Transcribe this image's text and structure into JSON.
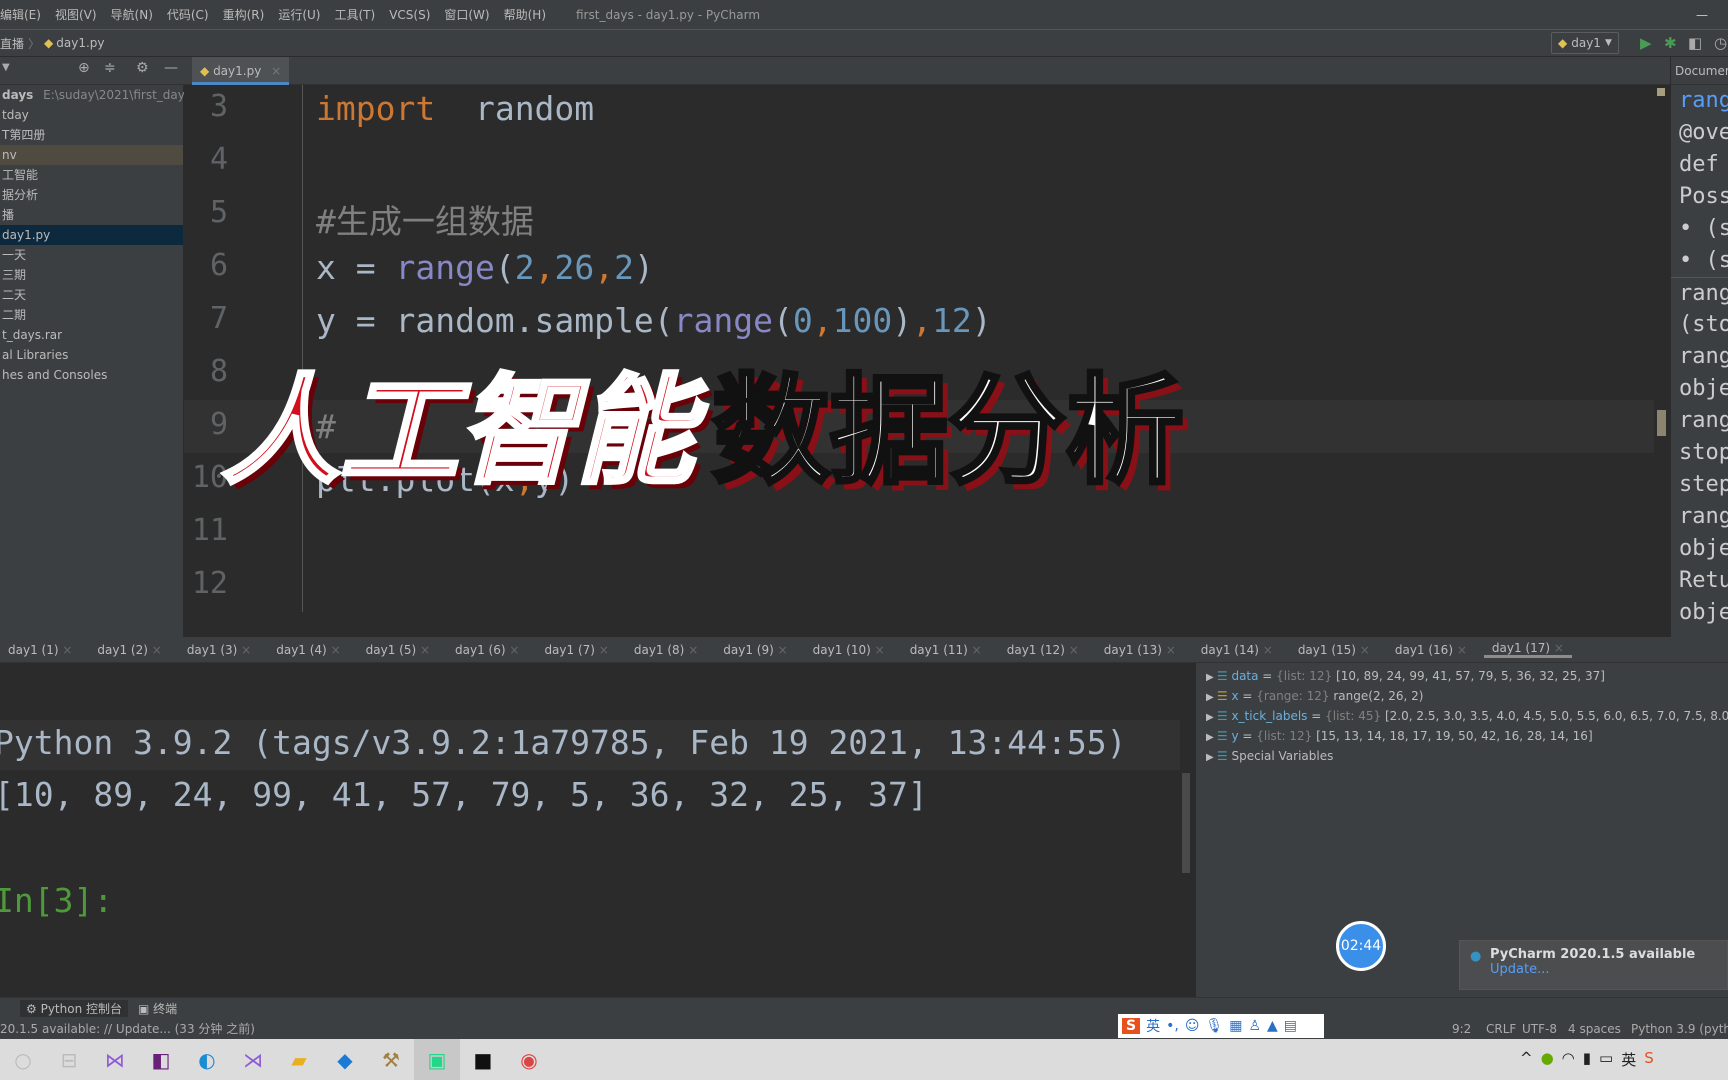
{
  "window": {
    "title": "first_days - day1.py - PyCharm"
  },
  "menu": [
    "编辑(E)",
    "视图(V)",
    "导航(N)",
    "代码(C)",
    "重构(R)",
    "运行(U)",
    "工具(T)",
    "VCS(S)",
    "窗口(W)",
    "帮助(H)"
  ],
  "breadcrumb": [
    "直播",
    "day1.py"
  ],
  "run_config": "day1",
  "project": {
    "root": "days",
    "root_path": "E:\\suday\\2021\\first_days",
    "items": [
      "tday",
      "T第四册",
      "nv",
      "工智能",
      "据分析",
      "播",
      "day1.py",
      "一天",
      "三期",
      "二天",
      "二期",
      "t_days.rar",
      "al Libraries",
      "hes and Consoles"
    ],
    "selected_index": 6,
    "highlight_index": 2
  },
  "editor": {
    "tab": "day1.py",
    "lines": [
      {
        "n": "3",
        "tokens": [
          {
            "t": "import",
            "c": "kw"
          },
          {
            "t": "  random",
            "c": "fn"
          }
        ]
      },
      {
        "n": "4",
        "tokens": []
      },
      {
        "n": "5",
        "tokens": [
          {
            "t": "#生成一组数据",
            "c": "cm"
          }
        ]
      },
      {
        "n": "6",
        "tokens": [
          {
            "t": "x = ",
            "c": "fn"
          },
          {
            "t": "range",
            "c": "bi"
          },
          {
            "t": "(",
            "c": "fn"
          },
          {
            "t": "2",
            "c": "num"
          },
          {
            "t": ",",
            "c": "kw"
          },
          {
            "t": "26",
            "c": "num"
          },
          {
            "t": ",",
            "c": "kw"
          },
          {
            "t": "2",
            "c": "num"
          },
          {
            "t": ")",
            "c": "fn"
          }
        ]
      },
      {
        "n": "7",
        "tokens": [
          {
            "t": "y = random.sample(",
            "c": "fn"
          },
          {
            "t": "range",
            "c": "bi"
          },
          {
            "t": "(",
            "c": "fn"
          },
          {
            "t": "0",
            "c": "num"
          },
          {
            "t": ",",
            "c": "kw"
          },
          {
            "t": "100",
            "c": "num"
          },
          {
            "t": ")",
            "c": "fn"
          },
          {
            "t": ",",
            "c": "kw"
          },
          {
            "t": "12",
            "c": "num"
          },
          {
            "t": ")",
            "c": "fn"
          }
        ]
      },
      {
        "n": "8",
        "tokens": []
      },
      {
        "n": "9",
        "tokens": [
          {
            "t": "#",
            "c": "cm"
          }
        ]
      },
      {
        "n": "10",
        "tokens": [
          {
            "t": "plt.plot(x",
            "c": "fn"
          },
          {
            "t": ",",
            "c": "kw"
          },
          {
            "t": "y)",
            "c": "fn"
          }
        ]
      },
      {
        "n": "11",
        "tokens": []
      },
      {
        "n": "12",
        "tokens": []
      }
    ]
  },
  "documentation": {
    "header": "Documen",
    "lines": [
      "rang",
      "@ove",
      "def",
      "Poss",
      "• (s",
      "• (s",
      "rang",
      "(stop",
      "rang",
      "obje",
      "rang",
      "stop",
      "step",
      "rang",
      "obje",
      "Retu",
      "obje"
    ]
  },
  "console_tabs": [
    "day1 (1)",
    "day1 (2)",
    "day1 (3)",
    "day1 (4)",
    "day1 (5)",
    "day1 (6)",
    "day1 (7)",
    "day1 (8)",
    "day1 (9)",
    "day1 (10)",
    "day1 (11)",
    "day1 (12)",
    "day1 (13)",
    "day1 (14)",
    "day1 (15)",
    "day1 (16)",
    "day1 (17)"
  ],
  "console": {
    "lines": [
      "Python 3.9.2 (tags/v3.9.2:1a79785, Feb 19 2021, 13:44:55)",
      "[10, 89, 24, 99, 41, 57, 79, 5, 36, 32, 25, 37]",
      "",
      "In[3]:"
    ]
  },
  "variables": [
    {
      "name": "data",
      "type": "{list: 12}",
      "value": "[10, 89, 24, 99, 41, 57, 79, 5, 36, 32, 25, 37]"
    },
    {
      "name": "x",
      "type": "{range: 12}",
      "value": "range(2, 26, 2)"
    },
    {
      "name": "x_tick_labels",
      "type": "{list: 45}",
      "value": "[2.0, 2.5, 3.0, 3.5, 4.0, 4.5, 5.0, 5.5, 6.0, 6.5, 7.0, 7.5, 8.0, 8.5, 9.0"
    },
    {
      "name": "y",
      "type": "{list: 12}",
      "value": "[15, 13, 14, 18, 17, 19, 50, 42, 16, 28, 14, 16]"
    },
    {
      "name": "Special Variables",
      "type": "",
      "value": ""
    }
  ],
  "overlay": {
    "part1": "人工智能",
    "part2": "数据分析"
  },
  "timer": "02:44",
  "notification": {
    "title": "PyCharm 2020.1.5 available",
    "link": "Update..."
  },
  "tool_tabs": [
    "Python 控制台",
    "终端"
  ],
  "status": {
    "left": "20.1.5 available: // Update... (33 分钟 之前)",
    "position": "9:2",
    "line_sep": "CRLF",
    "encoding": "UTF-8",
    "indent": "4 spaces",
    "interpreter": "Python 3.9 (pytho"
  },
  "ime": {
    "lang": "英"
  }
}
